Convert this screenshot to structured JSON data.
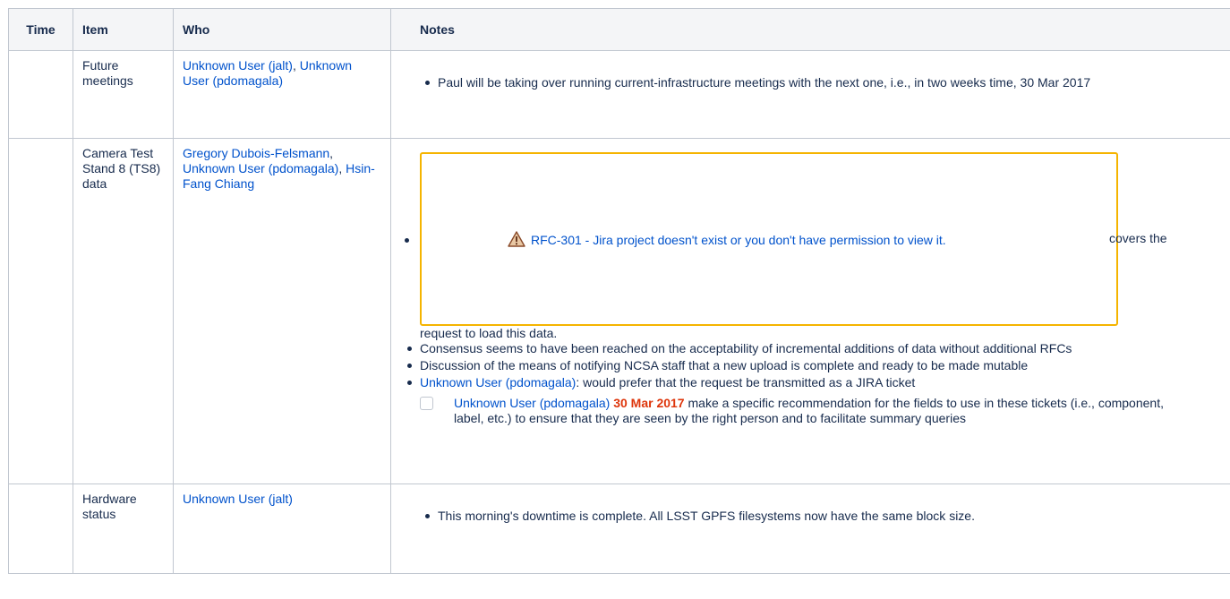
{
  "table": {
    "headers": {
      "time": "Time",
      "item": "Item",
      "who": "Who",
      "notes": "Notes"
    },
    "rows": [
      {
        "time": "",
        "item": "Future meetings",
        "who": {
          "p1": "Unknown User (jalt)",
          "sep1": ", ",
          "p2": "Unknown User (pdomagala)"
        },
        "notes": {
          "n1": "Paul will be taking over running current-infrastructure meetings with the next one, i.e., in two weeks time, 30 Mar 2017"
        }
      },
      {
        "time": "",
        "item": "Camera Test Stand 8 (TS8) data",
        "who": {
          "p1": "Gregory Dubois-Felsmann",
          "sep1": ",",
          "p2": "Unknown User (pdomagala)",
          "sep2": ", ",
          "p3": "Hsin-Fang Chiang"
        },
        "notes": {
          "jira_key": "RFC-301",
          "jira_msg": " - Jira project doesn't exist or you don't have permission to view it.",
          "after_box": "covers the",
          "after_box_2": "request to load this data.",
          "n2": "Consensus seems to have been reached on the acceptability of incremental additions of data without additional RFCs",
          "n3": "Discussion of the means of notifying NCSA staff that a new upload is complete and ready to be made mutable",
          "n4_user": "Unknown User (pdomagala)",
          "n4_text": ": would prefer that the request be transmitted as a JIRA ticket",
          "task": {
            "user": "Unknown User (pdomagala)",
            "date": "30 Mar 2017",
            "text": "make a specific recommendation for the fields to use in these tickets (i.e., component, label, etc.) to ensure that they are seen by the right person and to facilitate summary queries"
          }
        }
      },
      {
        "time": "",
        "item": "Hardware status",
        "who": {
          "p1": "Unknown User (jalt)"
        },
        "notes": {
          "n1": "This morning's downtime is complete. All LSST GPFS filesystems now have the same block size."
        }
      }
    ]
  },
  "icons": {
    "warning": "warning-triangle-icon"
  },
  "colors": {
    "link": "#0052cc",
    "due_date": "#de350b",
    "jira_border": "#f5b400",
    "header_bg": "#f4f5f7",
    "border": "#c1c7d0"
  }
}
